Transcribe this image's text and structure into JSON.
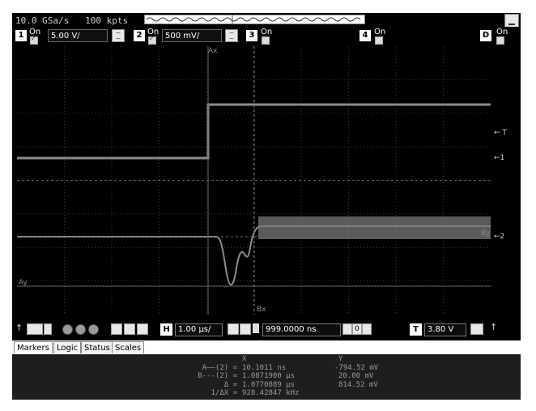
{
  "acquisition": {
    "text": "10.0 GSa/s   100 kpts"
  },
  "channels": [
    {
      "num": "1",
      "on_label": "On",
      "scale": "5.00 V/"
    },
    {
      "num": "2",
      "on_label": "On",
      "scale": "500 mV/"
    },
    {
      "num": "3",
      "on_label": "On"
    },
    {
      "num": "4",
      "on_label": "On"
    },
    {
      "num": "D",
      "on_label": "On"
    }
  ],
  "graticule_labels": {
    "ax": "Ax",
    "bx": "Bx",
    "ay": "Ay",
    "by": "By",
    "trigger_mark": "T",
    "ch1_mark": "1",
    "ch2_mark": "2"
  },
  "controls": {
    "horizontal_button": "H",
    "time_scale": "1.00 µs/",
    "delay": "999.0000 ns",
    "zoom_value": "0",
    "trigger_button": "T",
    "trigger_level": "3.80 V"
  },
  "tabs": [
    {
      "label": "Markers"
    },
    {
      "label": "Logic"
    },
    {
      "label": "Status"
    },
    {
      "label": "Scales"
    }
  ],
  "markers": {
    "x_header": "X",
    "y_header": "Y",
    "rows": [
      {
        "label": "A——(2) =",
        "x": "10.1011 ns",
        "y": "-794.52 mV"
      },
      {
        "label": "B---(2) =",
        "x": "1.0871900 µs",
        "y": "20.00 mV"
      },
      {
        "label": "Δ =",
        "x": "1.0770889 µs",
        "y": "814.52 mV"
      },
      {
        "label": "1/ΔX =",
        "x": "928.42847 kHz",
        "y": ""
      }
    ]
  },
  "colors": {
    "trace": "#9a9a9a",
    "grid": "#5a5a5a",
    "background": "#000000"
  }
}
